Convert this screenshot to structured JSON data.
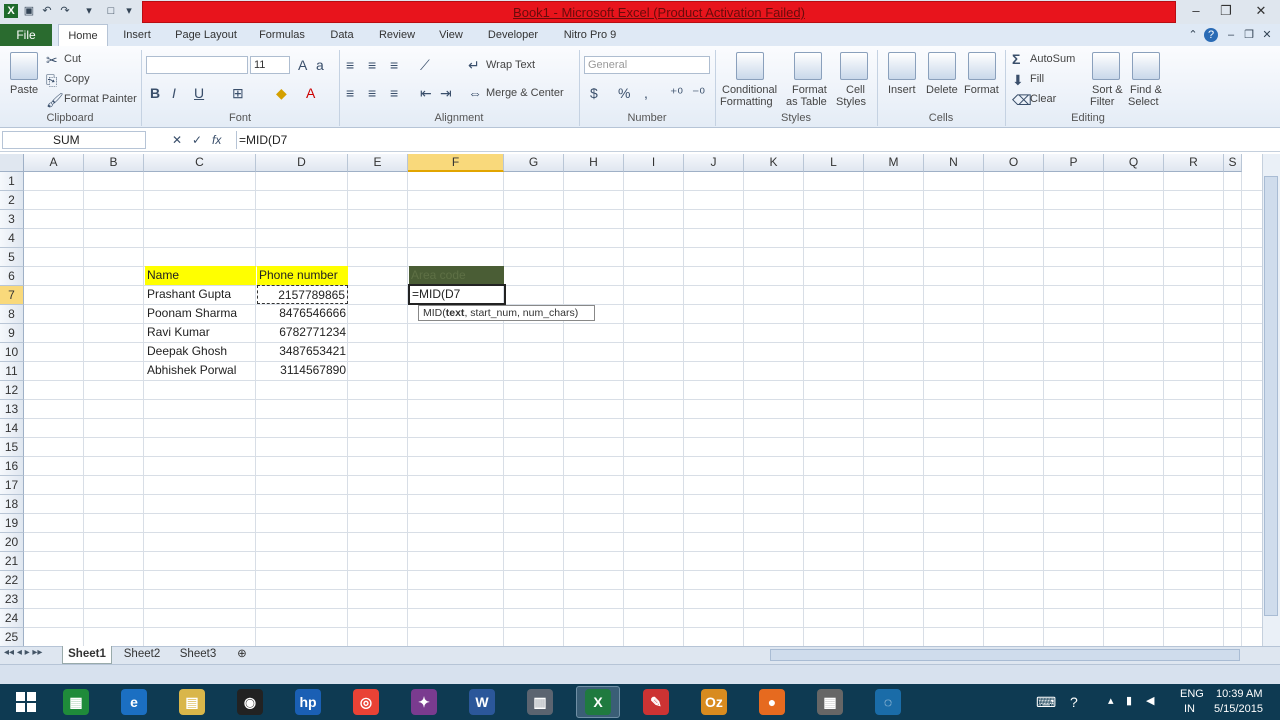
{
  "window": {
    "title": "Book1 - Microsoft Excel (Product Activation Failed)",
    "excel_icon": "excel-icon",
    "min": "–",
    "max": "❐",
    "close": "✕"
  },
  "ribbon_tabs": [
    "File",
    "Home",
    "Insert",
    "Page Layout",
    "Formulas",
    "Data",
    "Review",
    "View",
    "Developer",
    "Nitro Pro 9"
  ],
  "clipboard": {
    "paste": "Paste",
    "cut": "Cut",
    "copy": "Copy",
    "format_painter": "Format Painter",
    "label": "Clipboard"
  },
  "font": {
    "size": "11",
    "label": "Font",
    "bold": "B",
    "italic": "I",
    "underline": "U"
  },
  "alignment": {
    "wrap_text": "Wrap Text",
    "merge_center": "Merge & Center",
    "label": "Alignment"
  },
  "number": {
    "format": "General",
    "label": "Number",
    "currency": "$",
    "percent": "%",
    "comma": ","
  },
  "styles": {
    "conditional": "Conditional",
    "conditional2": "Formatting",
    "format_as": "Format",
    "format_as2": "as Table",
    "cell": "Cell",
    "cell2": "Styles",
    "label": "Styles"
  },
  "cells": {
    "insert": "Insert",
    "delete": "Delete",
    "format": "Format",
    "label": "Cells"
  },
  "editing": {
    "autosum": "AutoSum",
    "fill": "Fill",
    "clear": "Clear",
    "sort": "Sort &",
    "sort2": "Filter",
    "find": "Find &",
    "find2": "Select",
    "label": "Editing"
  },
  "formula_bar": {
    "name_box": "SUM",
    "formula": "=MID(D7",
    "fx": "fx",
    "cancel": "✕",
    "enter": "✓"
  },
  "columns": [
    "A",
    "B",
    "C",
    "D",
    "E",
    "F",
    "G",
    "H",
    "I",
    "J",
    "K",
    "L",
    "M",
    "N",
    "O",
    "P",
    "Q",
    "R",
    "S"
  ],
  "rows": [
    "1",
    "2",
    "3",
    "4",
    "5",
    "6",
    "7",
    "8",
    "9",
    "10",
    "11",
    "12",
    "13",
    "14",
    "15",
    "16",
    "17",
    "18",
    "19",
    "20",
    "21",
    "22",
    "23",
    "24",
    "25"
  ],
  "table": {
    "name_header": "Name",
    "phone_header": "Phone number",
    "area_header": "Area code",
    "names": [
      "Prashant Gupta",
      "Poonam Sharma",
      "Ravi Kumar",
      "Deepak Ghosh",
      "Abhishek Porwal"
    ],
    "phones": [
      "2157789865",
      "8476546666",
      "6782771234",
      "3487653421",
      "3114567890"
    ],
    "f7": "=MID(D7"
  },
  "tooltip": {
    "fn": "MID(",
    "bold_arg": "text",
    "rest": ", start_num, num_chars)"
  },
  "sheets": [
    "Sheet1",
    "Sheet2",
    "Sheet3"
  ],
  "colors": {
    "title_red": "#e8141c",
    "header_yellow": "#ffff00",
    "area_fill": "#4a5d35",
    "file_tab": "#2a6b2f",
    "taskbar": "#0e3a52"
  },
  "taskbar": {
    "apps": [
      "windows-store-icon",
      "internet-explorer-icon",
      "file-explorer-icon",
      "camera-icon",
      "hp-icon",
      "chrome-icon",
      "media-icon",
      "word-icon",
      "files-icon",
      "excel-icon",
      "paint-icon",
      "outlook-icon",
      "firefox-icon",
      "calculator-icon",
      "teamviewer-icon"
    ],
    "lang1": "ENG",
    "lang2": "IN",
    "time": "10:39 AM",
    "date": "5/15/2015"
  }
}
